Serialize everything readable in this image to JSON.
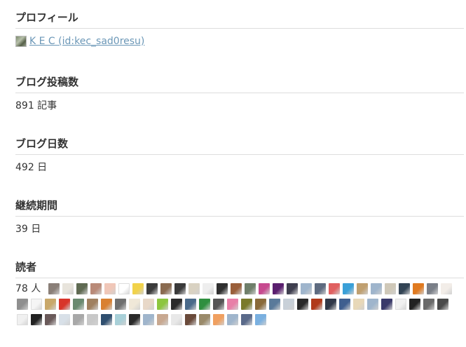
{
  "profile": {
    "title": "プロフィール",
    "name": " K E C  (id:kec_sad0resu)"
  },
  "posts": {
    "title": "ブログ投稿数",
    "value": "891 記事"
  },
  "days": {
    "title": "ブログ日数",
    "value": "492 日"
  },
  "duration": {
    "title": "継続期間",
    "value": "39 日"
  },
  "readers": {
    "title": "読者",
    "count": "78 人",
    "icons": [
      "#8a7f78",
      "#e8e4dc",
      "#5f6a52",
      "#b98a78",
      "#f0c7b8",
      "#ffffff",
      "#f1d24a",
      "#3b3b3b",
      "#8a6b50",
      "#3a3a3a",
      "#d9d2c2",
      "#eeeeee",
      "#2f2f2f",
      "#9a5f3a",
      "#6f7f6a",
      "#c74a8f",
      "#5a1f6f",
      "#3f3f4f",
      "#9fb5cc",
      "#5e6b80",
      "#e06060",
      "#3aa0d8",
      "#c0a070",
      "#9fb5cc",
      "#cfc8b8",
      "#334455",
      "#e07a20",
      "#7a7f88",
      "#f2ede8",
      "#8f8f8f",
      "#f5f5f5",
      "#c9a86a",
      "#d8352a",
      "#6a8a70",
      "#a08060",
      "#d98030",
      "#6f6f6f",
      "#f0e8d8",
      "#e8d8c8",
      "#8dc63f",
      "#2a2a2a",
      "#4a6a8a",
      "#2f8f3f",
      "#555555",
      "#e87fa8",
      "#7a7a2a",
      "#8a6a3a",
      "#5a7a9a",
      "#c8d0d8",
      "#2a2a2a",
      "#b03a1a",
      "#303848",
      "#3f5f8f",
      "#e8d8b8",
      "#9fb5cc",
      "#3a3a6a",
      "#f0f0f0",
      "#222222",
      "#6a6a6a",
      "#4a4a4a",
      "#f0f0f0",
      "#222222",
      "#6a5a5a",
      "#d8e0e8",
      "#a8a8a8",
      "#c8c8c8",
      "#2f4f6f",
      "#a8d0d8",
      "#2a2a2a",
      "#9fb5cc",
      "#c8a890",
      "#e8e8e8",
      "#6a4a3a",
      "#9a8a6a",
      "#f0a060",
      "#9fb5cc",
      "#5a6a8a",
      "#7ab0e0"
    ]
  }
}
